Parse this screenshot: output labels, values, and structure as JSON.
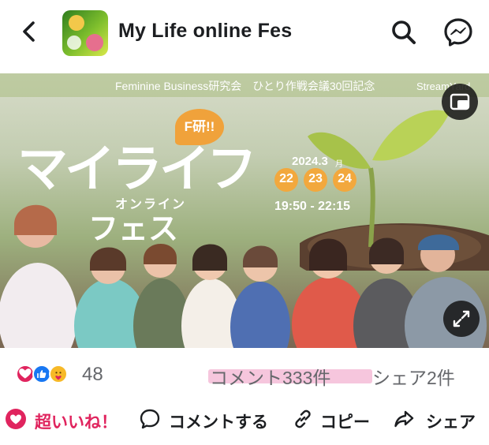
{
  "header": {
    "title": "My Life online Fes",
    "icons": {
      "back": "chevron-left-icon",
      "search": "search-icon",
      "messenger": "messenger-icon"
    }
  },
  "media": {
    "banner_text": "Feminine Business研究会　ひとり作戦会議30回記念",
    "stream_text": "StreamYard",
    "title_main": "マイライフ",
    "title_sub": "オンライン",
    "title_bottom": "フェス",
    "badge": "F研!!",
    "year": "2024.3",
    "month_suffix": "月",
    "days": [
      "22",
      "23",
      "24"
    ],
    "time": "19:50 - 22:15"
  },
  "engagement": {
    "reaction_count": "48",
    "comment_count": "コメント333件",
    "share_count": "シェア2件",
    "reaction_types": [
      "love",
      "like",
      "care"
    ]
  },
  "actions": {
    "super_like": "超いいね！",
    "comment": "コメントする",
    "copy": "コピー",
    "share": "シェア"
  },
  "colors": {
    "love": "#e0245e",
    "like": "#1877f2",
    "care": "#f7b928",
    "comment_highlight": "#f6c6dd",
    "date_badge": "#f2a83d"
  }
}
